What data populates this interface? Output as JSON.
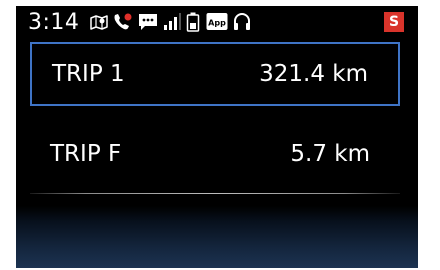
{
  "status_bar": {
    "time": "3:14",
    "icons": [
      "maps-icon",
      "missed-call-icon",
      "message-icon",
      "signal-icon",
      "battery-icon",
      "app-icon",
      "headset-icon"
    ],
    "app_label": "App",
    "badge": "S",
    "badge_color": "#d9342b"
  },
  "trips": [
    {
      "label": "TRIP 1",
      "value": "321.4 km",
      "selected": true
    },
    {
      "label": "TRIP F",
      "value": "5.7 km",
      "selected": false
    }
  ],
  "colors": {
    "selection_border": "#3f74c6",
    "missed_call": "#e0302a"
  }
}
